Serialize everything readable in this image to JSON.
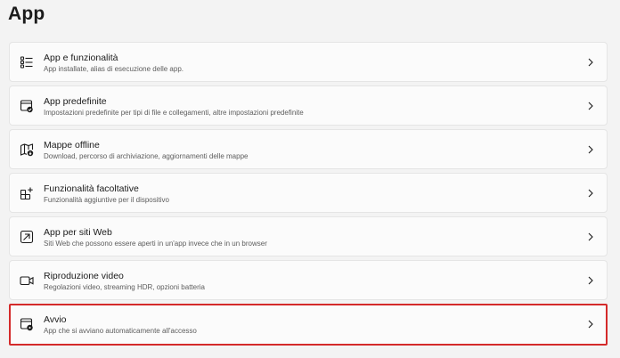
{
  "page": {
    "title": "App"
  },
  "items": [
    {
      "icon": "apps-list-icon",
      "title": "App e funzionalità",
      "desc": "App installate, alias di esecuzione delle app."
    },
    {
      "icon": "default-apps-icon",
      "title": "App predefinite",
      "desc": "Impostazioni predefinite per tipi di file e collegamenti, altre impostazioni predefinite"
    },
    {
      "icon": "offline-map-icon",
      "title": "Mappe offline",
      "desc": "Download, percorso di archiviazione, aggiornamenti delle mappe"
    },
    {
      "icon": "optional-features-icon",
      "title": "Funzionalità facoltative",
      "desc": "Funzionalità aggiuntive per il dispositivo"
    },
    {
      "icon": "web-apps-icon",
      "title": "App per siti Web",
      "desc": "Siti Web che possono essere aperti in un'app invece che in un browser"
    },
    {
      "icon": "video-camera-icon",
      "title": "Riproduzione video",
      "desc": "Regolazioni video, streaming HDR, opzioni batteria"
    },
    {
      "icon": "startup-apps-icon",
      "title": "Avvio",
      "desc": "App che si avviano automaticamente all'accesso"
    }
  ],
  "colors": {
    "highlight_border": "#d42a2a",
    "card_bg": "#fbfbfb",
    "page_bg": "#f3f3f3"
  }
}
